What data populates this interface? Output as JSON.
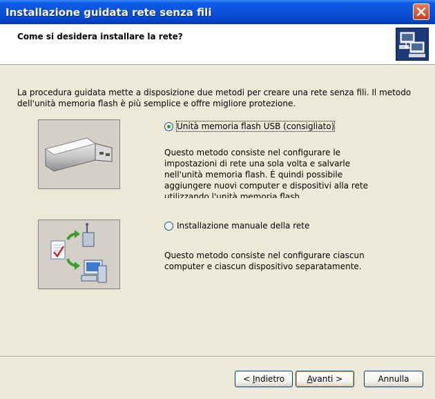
{
  "window": {
    "title": "Installazione guidata rete senza fili"
  },
  "header": {
    "title": "Come si desidera installare la rete?",
    "icon": "network-computers-icon"
  },
  "intro": "La procedura guidata mette a disposizione due metodi per creare una rete senza fili. Il metodo dell'unità memoria flash è più semplice e offre migliore protezione.",
  "options": {
    "usb": {
      "label": "Unità memoria flash USB (consigliato)",
      "selected": true,
      "icon": "usb-flash-drive-icon",
      "description": "Questo metodo consiste nel configurare le impostazioni di rete una sola volta e salvarle nell'unità memoria flash. È quindi possibile aggiungere nuovi computer e dispositivi alla rete utilizzando l'unità memoria flash."
    },
    "manual": {
      "label": "Installazione manuale della rete",
      "selected": false,
      "icon": "manual-network-setup-icon",
      "description": "Questo metodo consiste nel configurare ciascun computer e ciascun dispositivo separatamente."
    }
  },
  "buttons": {
    "back_prefix": "< ",
    "back_access": "I",
    "back_rest": "ndietro",
    "next_access": "A",
    "next_rest": "vanti >",
    "cancel": "Annulla"
  },
  "colors": {
    "title_bar": "#0A50D8",
    "dialog_bg": "#ECE9D8",
    "radio_selected": "#21A121",
    "close_button": "#C8401C"
  }
}
